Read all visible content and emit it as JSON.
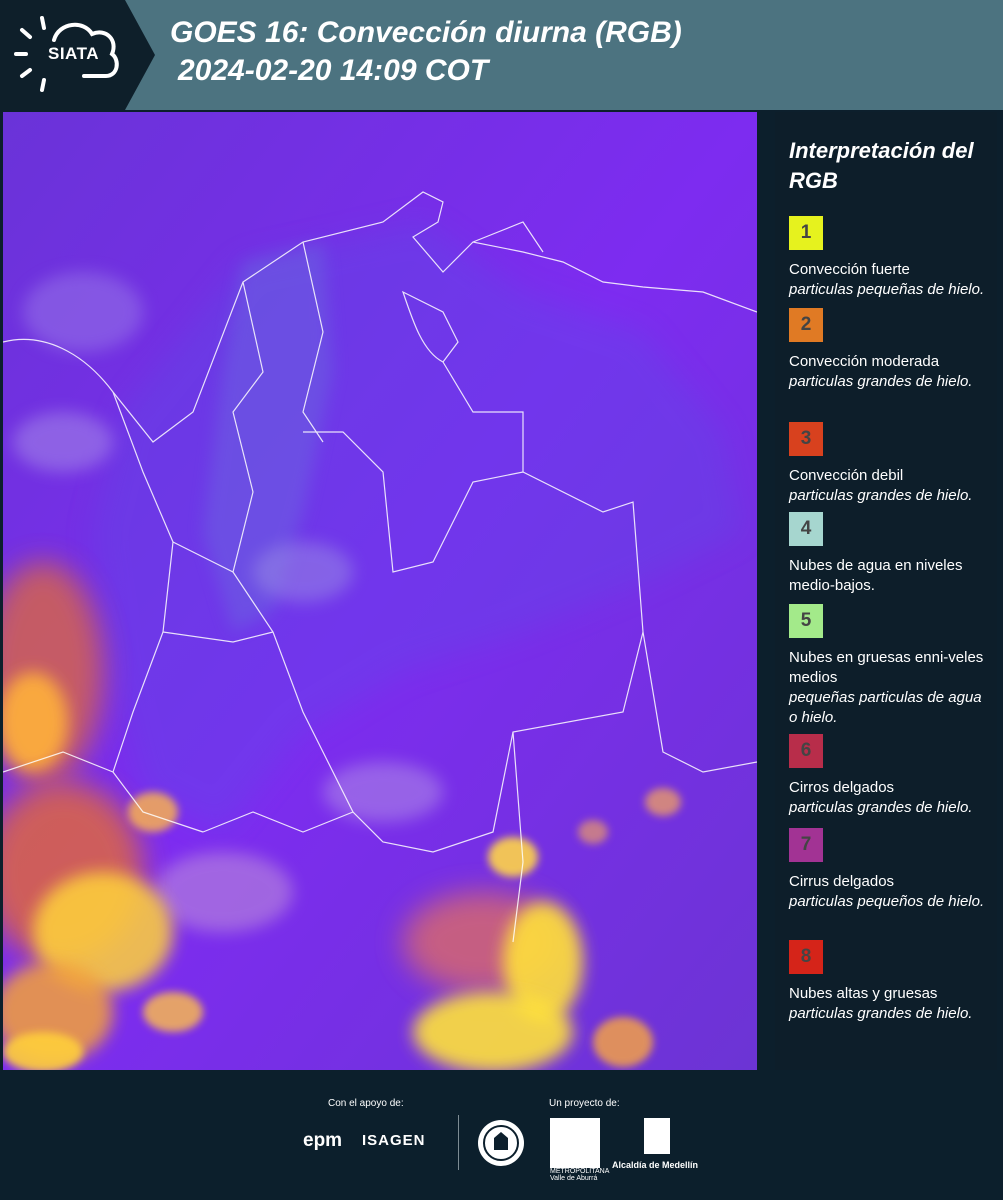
{
  "header": {
    "logo_text": "SIATA",
    "title_line1": "GOES 16: Convección diurna (RGB)",
    "title_line2": "2024-02-20 14:09 COT"
  },
  "legend": {
    "title": "Interpretación del RGB",
    "items": [
      {
        "num": "1",
        "color": "#e6f21e",
        "name": "Convección fuerte",
        "desc": "particulas pequeñas de hielo."
      },
      {
        "num": "2",
        "color": "#e07a24",
        "name": "Convección moderada",
        "desc": "particulas grandes de hielo."
      },
      {
        "num": "3",
        "color": "#d8411e",
        "name": "Convección debil",
        "desc": "particulas grandes de hielo."
      },
      {
        "num": "4",
        "color": "#a6d6cf",
        "name": "Nubes de agua en niveles medio-bajos.",
        "desc": ""
      },
      {
        "num": "5",
        "color": "#a3ea8a",
        "name": "Nubes en gruesas enni-veles medios",
        "desc": "pequeñas particulas de agua o hielo."
      },
      {
        "num": "6",
        "color": "#b82d4a",
        "name": "Cirros delgados",
        "desc": "particulas grandes de hielo."
      },
      {
        "num": "7",
        "color": "#a23394",
        "name": "Cirrus delgados",
        "desc": "particulas pequeños de hielo."
      },
      {
        "num": "8",
        "color": "#d52419",
        "name": "Nubes altas y gruesas",
        "desc": "particulas grandes de hielo."
      }
    ]
  },
  "footer": {
    "support_label": "Con el apoyo de:",
    "project_label": "Un proyecto de:",
    "sponsor1": "epm",
    "sponsor2": "ISAGEN",
    "area_text": "METROPOLITANA Valle de Aburrá",
    "alcaldia": "Alcaldía de Medellín"
  }
}
